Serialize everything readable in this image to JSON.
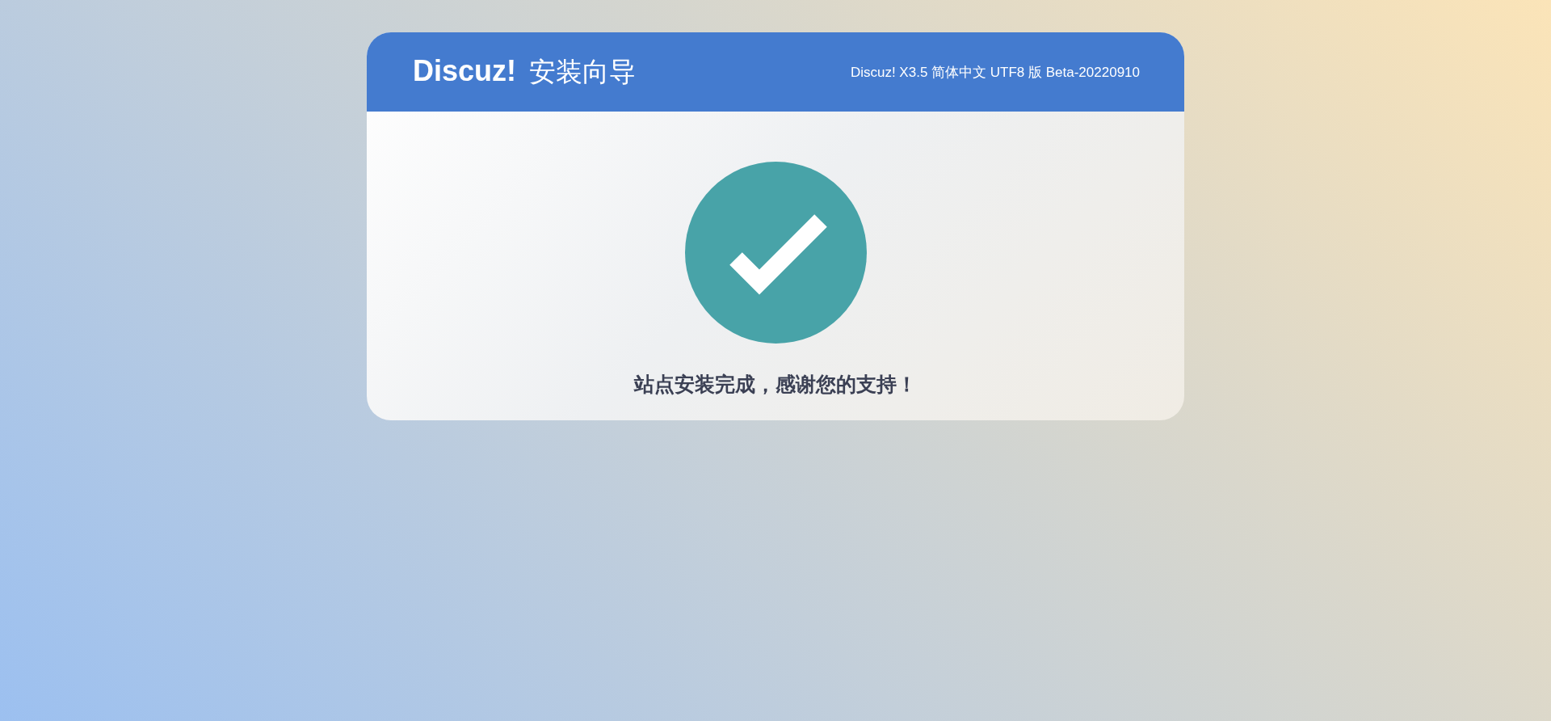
{
  "header": {
    "logo": "Discuz!",
    "title": "安装向导",
    "version": "Discuz! X3.5 简体中文 UTF8 版 Beta-20220910"
  },
  "message": "站点安装完成，感谢您的支持！"
}
